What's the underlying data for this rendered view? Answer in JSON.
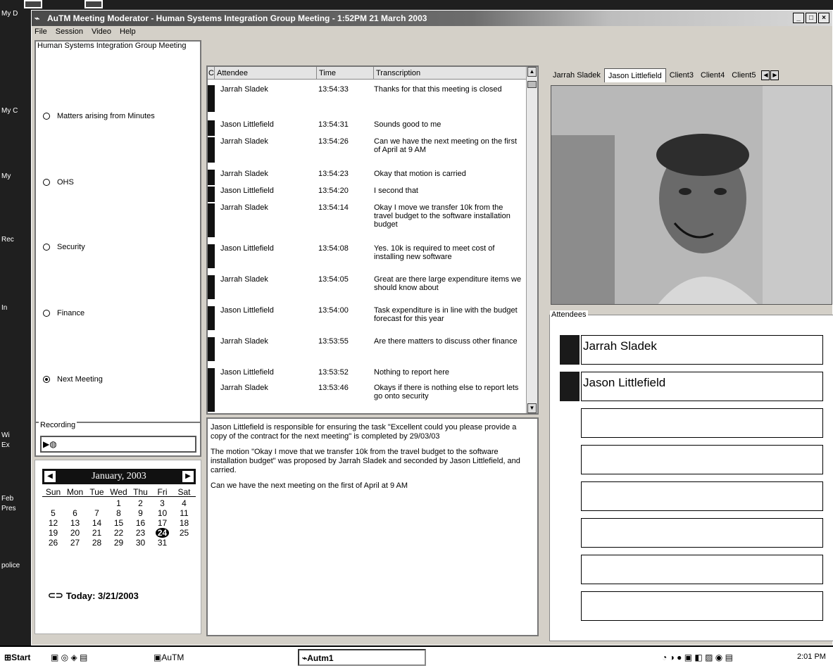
{
  "desktop": {
    "icons": [
      "My D",
      "My C",
      "My",
      "Rec",
      "In",
      "Wi",
      "Ex",
      "Feb",
      "Pres",
      "police"
    ]
  },
  "window": {
    "title": "AuTM Meeting Moderator - Human Systems Integration Group Meeting - 1:52PM 21 March 2003",
    "minimize": "_",
    "maximize": "□",
    "close": "×"
  },
  "menu": [
    "File",
    "Session",
    "Video",
    "Help"
  ],
  "agenda": {
    "title": "Human Systems Integration Group Meeting",
    "items": [
      {
        "label": "Matters arising from Minutes",
        "selected": false
      },
      {
        "label": "OHS",
        "selected": false
      },
      {
        "label": "Security",
        "selected": false
      },
      {
        "label": "Finance",
        "selected": false
      },
      {
        "label": "Next Meeting",
        "selected": true
      }
    ]
  },
  "recording": {
    "label": "Recording"
  },
  "calendar": {
    "month": "January, 2003",
    "days": [
      "Sun",
      "Mon",
      "Tue",
      "Wed",
      "Thu",
      "Fri",
      "Sat"
    ],
    "weeks": [
      [
        "",
        "",
        "",
        "1",
        "2",
        "3",
        "4"
      ],
      [
        "5",
        "6",
        "7",
        "8",
        "9",
        "10",
        "11"
      ],
      [
        "12",
        "13",
        "14",
        "15",
        "16",
        "17",
        "18"
      ],
      [
        "19",
        "20",
        "21",
        "22",
        "23",
        "24",
        "25"
      ],
      [
        "26",
        "27",
        "28",
        "29",
        "30",
        "31",
        ""
      ]
    ],
    "today": "Today: 3/21/2003"
  },
  "transcript": {
    "columns": [
      "C",
      "Attendee",
      "Time",
      "Transcription"
    ],
    "rows": [
      {
        "attendee": "Jarrah Sladek",
        "time": "13:54:33",
        "text": "Thanks for that this meeting is closed"
      },
      {
        "attendee": "Jason Littlefield",
        "time": "13:54:31",
        "text": "Sounds good to me"
      },
      {
        "attendee": "Jarrah Sladek",
        "time": "13:54:26",
        "text": "Can we have the next meeting on the first of April at 9 AM"
      },
      {
        "attendee": "Jarrah Sladek",
        "time": "13:54:23",
        "text": "Okay that motion is carried"
      },
      {
        "attendee": "Jason Littlefield",
        "time": "13:54:20",
        "text": "I second that"
      },
      {
        "attendee": "Jarrah Sladek",
        "time": "13:54:14",
        "text": "Okay I move we transfer 10k from the travel budget to the software installation budget"
      },
      {
        "attendee": "Jason Littlefield",
        "time": "13:54:08",
        "text": "Yes. 10k is required to meet cost of installing new software"
      },
      {
        "attendee": "Jarrah Sladek",
        "time": "13:54:05",
        "text": "Great are there large expenditure items we should know about"
      },
      {
        "attendee": "Jason Littlefield",
        "time": "13:54:00",
        "text": "Task expenditure is in line with the budget forecast for this year"
      },
      {
        "attendee": "Jarrah Sladek",
        "time": "13:53:55",
        "text": "Are there matters to discuss other finance"
      },
      {
        "attendee": "Jason Littlefield",
        "time": "13:53:52",
        "text": "Nothing to report here"
      },
      {
        "attendee": "Jarrah Sladek",
        "time": "13:53:46",
        "text": "Okays if there is nothing else to report lets go onto security"
      }
    ]
  },
  "summary": [
    "Jason Littlefield is responsible for ensuring the task \"Excellent could you please provide a copy of the contract for the next meeting\" is completed by 29/03/03",
    "The motion \"Okay I move that we transfer 10k from the travel budget to the software installation budget\" was proposed by Jarrah Sladek and seconded by Jason Littlefield, and carried.",
    "Can we have the next meeting on the first of April at 9 AM"
  ],
  "tabs": [
    "Jarrah Sladek",
    "Jason Littlefield",
    "Client3",
    "Client4",
    "Client5"
  ],
  "active_tab": "Jason Littlefield",
  "attendees": {
    "label": "Attendees",
    "names": [
      "Jarrah Sladek",
      "Jason Littlefield",
      "",
      "",
      "",
      "",
      "",
      ""
    ]
  },
  "taskbar": {
    "start": "Start",
    "items": [
      "AuTM",
      "Autm1"
    ],
    "clock": "2:01 PM"
  }
}
